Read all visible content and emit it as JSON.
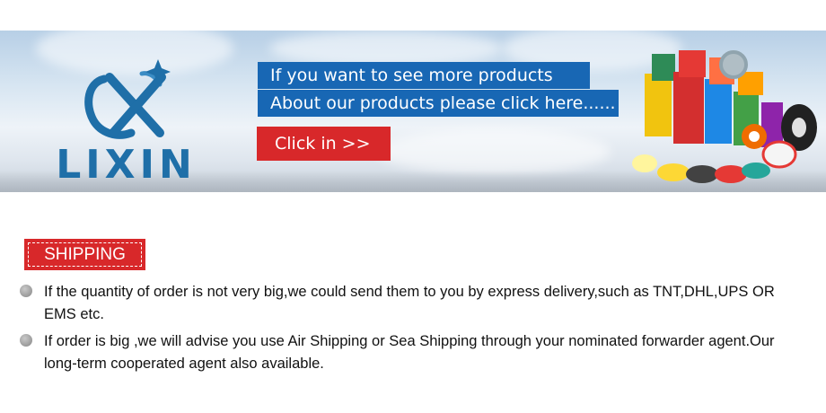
{
  "banner": {
    "brand": "LIXIN",
    "promo_line_1": "If you want to see more products",
    "promo_line_2": "About our products please click here......",
    "click_label": "Click in >>",
    "colors": {
      "promo_blue": "#1867b4",
      "button_red": "#d8282a",
      "brand_blue": "#1f6fa8"
    },
    "image": "adhesive-tape-rolls"
  },
  "shipping": {
    "tag": "SHIPPING",
    "bullets": [
      {
        "text": "If the quantity of order is not very big,we could send them to you by express delivery,such as TNT,DHL,UPS OR EMS etc."
      },
      {
        "text": "If order is big ,we will advise you use Air Shipping or Sea Shipping through your nominated forwarder agent.Our long-term cooperated agent also available."
      }
    ]
  }
}
